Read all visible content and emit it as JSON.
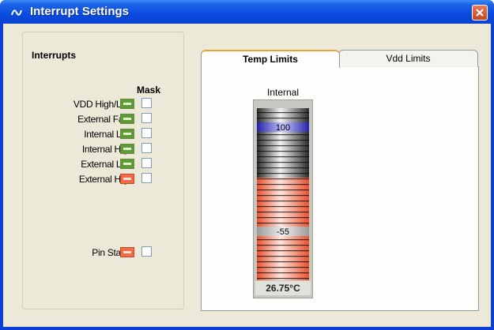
{
  "window": {
    "title": "Interrupt Settings"
  },
  "interrupts": {
    "group_title": "Interrupts",
    "mask_header": "Mask",
    "rows": [
      {
        "label": "VDD High/Low",
        "led": "green",
        "masked": false
      },
      {
        "label": "External Fault",
        "led": "green",
        "masked": false
      },
      {
        "label": "Internal Low",
        "led": "green",
        "masked": false
      },
      {
        "label": "Internal High",
        "led": "green",
        "masked": false
      },
      {
        "label": "External Low",
        "led": "green",
        "masked": false
      },
      {
        "label": "External High",
        "led": "red",
        "masked": false
      }
    ],
    "pin_status": {
      "label": "Pin Status",
      "led": "red",
      "masked": false
    }
  },
  "tabs": [
    {
      "label": "Temp Limits",
      "active": true
    },
    {
      "label": "Vdd Limits",
      "active": false
    }
  ],
  "gauge": {
    "label": "Internal",
    "high_limit": "100",
    "low_limit": "-55",
    "reading": "26.75°C"
  },
  "colors": {
    "titlebar": "#0a4be0",
    "led_green": "#5c9a3a",
    "led_red": "#f26a48",
    "gauge_upper": "#1e1e1e",
    "gauge_lower": "#f06a4e",
    "limit_marker": "#3a3acc"
  },
  "icons": {
    "app": "chart-wave-icon",
    "close": "close-icon"
  }
}
